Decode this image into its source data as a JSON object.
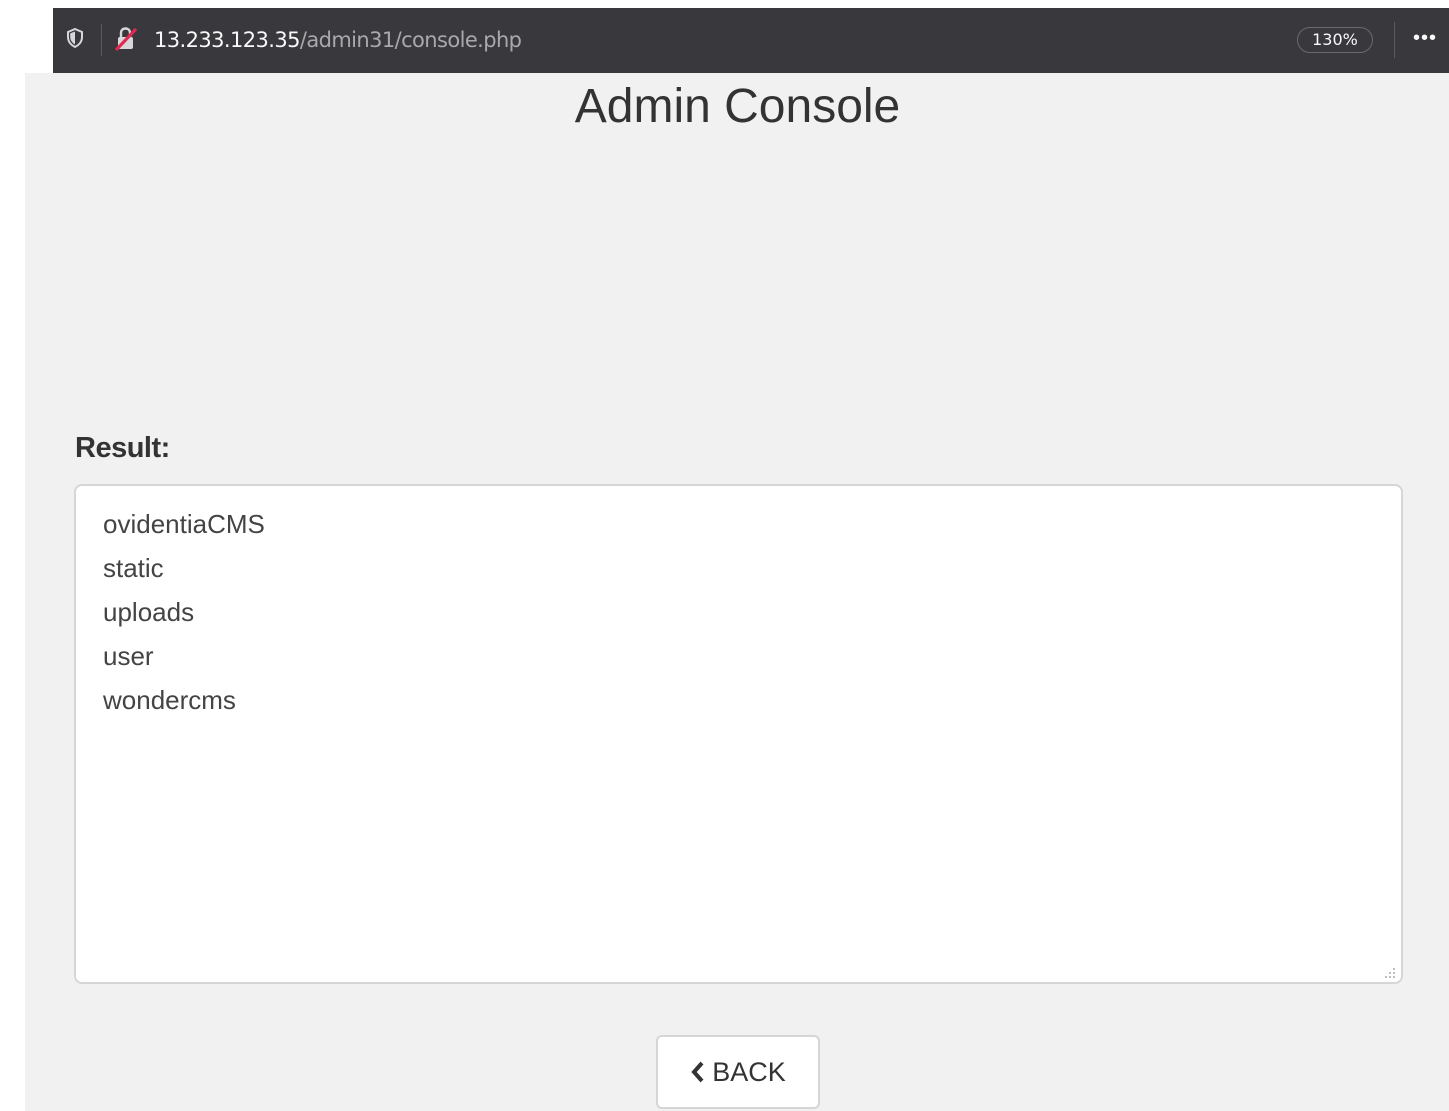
{
  "browser": {
    "url_host": "13.233.123.35",
    "url_path": "/admin31/console.php",
    "zoom": "130%",
    "more_label": "•••",
    "icons": [
      "shield-icon",
      "insecure-lock-icon",
      "more-icon"
    ]
  },
  "page": {
    "title": "Admin Console",
    "result_label": "Result:",
    "result_lines": [
      "ovidentiaCMS",
      "static",
      "uploads",
      "user",
      "wondercms"
    ],
    "back_label": "BACK"
  }
}
